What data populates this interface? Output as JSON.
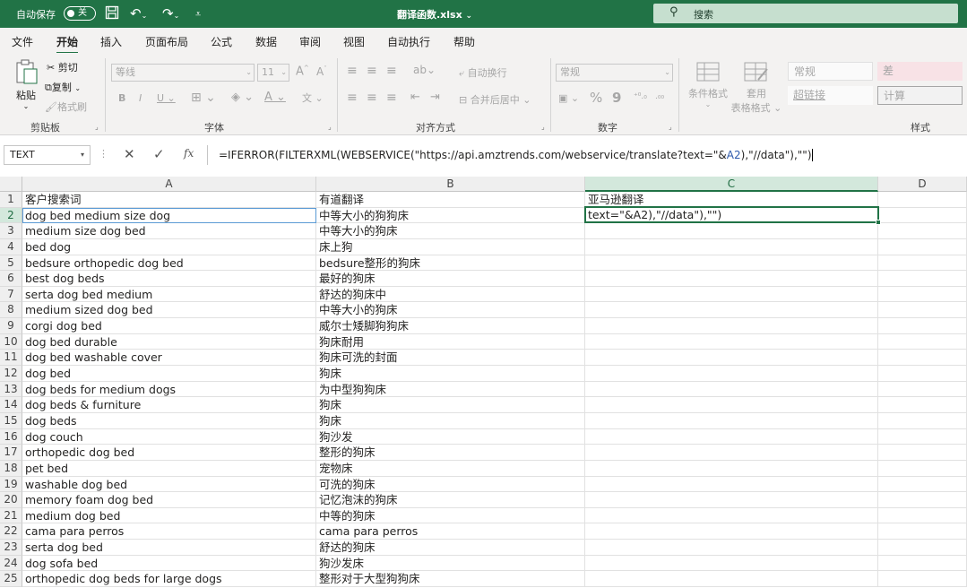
{
  "titlebar": {
    "autosave_label": "自动保存",
    "autosave_state": "关",
    "filename": "翻译函数.xlsx",
    "search_label": "搜索"
  },
  "tabs": [
    "文件",
    "开始",
    "插入",
    "页面布局",
    "公式",
    "数据",
    "审阅",
    "视图",
    "自动执行",
    "帮助"
  ],
  "ribbon": {
    "clipboard": {
      "paste": "粘贴",
      "cut": "剪切",
      "copy": "复制",
      "format_painter": "格式刷",
      "group": "剪贴板"
    },
    "font": {
      "font_name": "等线",
      "font_size": "11",
      "group": "字体"
    },
    "alignment": {
      "wrap": "自动换行",
      "merge": "合并后居中",
      "group": "对齐方式"
    },
    "number": {
      "format": "常规",
      "percent": "%",
      "comma": "9",
      "group": "数字"
    },
    "styles": {
      "conditional": "条件格式",
      "table_format_1": "套用",
      "table_format_2": "表格格式",
      "normal": "常规",
      "bad": "差",
      "hyperlink": "超链接",
      "calc": "计算",
      "group": "样式"
    }
  },
  "formula_bar": {
    "name_box": "TEXT",
    "formula_before": "=IFERROR(FILTERXML(WEBSERVICE(\"https://api.amztrends.com/webservice/translate?text=\"&",
    "formula_ref": "A2",
    "formula_after": "),\"//data\"),\"\")"
  },
  "columns": [
    "A",
    "B",
    "C",
    "D"
  ],
  "active_cell_text": "text=\"&A2),\"//data\"),\"\")",
  "rows": [
    {
      "n": "1",
      "a": "客户搜索词",
      "b": "有道翻译",
      "c": "亚马逊翻译"
    },
    {
      "n": "2",
      "a": "dog bed medium size dog",
      "b": "中等大小的狗狗床",
      "c": ""
    },
    {
      "n": "3",
      "a": "medium size dog bed",
      "b": "中等大小的狗床",
      "c": ""
    },
    {
      "n": "4",
      "a": "bed dog",
      "b": "床上狗",
      "c": ""
    },
    {
      "n": "5",
      "a": "bedsure orthopedic dog bed",
      "b": "bedsure整形的狗床",
      "c": ""
    },
    {
      "n": "6",
      "a": "best dog beds",
      "b": "最好的狗床",
      "c": ""
    },
    {
      "n": "7",
      "a": "serta dog bed medium",
      "b": "舒达的狗床中",
      "c": ""
    },
    {
      "n": "8",
      "a": "medium sized dog bed",
      "b": "中等大小的狗床",
      "c": ""
    },
    {
      "n": "9",
      "a": "corgi dog bed",
      "b": "威尔士矮脚狗狗床",
      "c": ""
    },
    {
      "n": "10",
      "a": "dog bed durable",
      "b": "狗床耐用",
      "c": ""
    },
    {
      "n": "11",
      "a": "dog bed washable cover",
      "b": "狗床可洗的封面",
      "c": ""
    },
    {
      "n": "12",
      "a": "dog bed",
      "b": "狗床",
      "c": ""
    },
    {
      "n": "13",
      "a": "dog beds for medium dogs",
      "b": "为中型狗狗床",
      "c": ""
    },
    {
      "n": "14",
      "a": "dog beds & furniture",
      "b": "狗床",
      "c": ""
    },
    {
      "n": "15",
      "a": "dog beds",
      "b": "狗床",
      "c": ""
    },
    {
      "n": "16",
      "a": "dog couch",
      "b": "狗沙发",
      "c": ""
    },
    {
      "n": "17",
      "a": "orthopedic dog bed",
      "b": "整形的狗床",
      "c": ""
    },
    {
      "n": "18",
      "a": "pet bed",
      "b": "宠物床",
      "c": ""
    },
    {
      "n": "19",
      "a": "washable dog bed",
      "b": "可洗的狗床",
      "c": ""
    },
    {
      "n": "20",
      "a": "memory foam dog bed",
      "b": "记忆泡沫的狗床",
      "c": ""
    },
    {
      "n": "21",
      "a": "medium dog bed",
      "b": "中等的狗床",
      "c": ""
    },
    {
      "n": "22",
      "a": "cama para perros",
      "b": "cama para perros",
      "c": ""
    },
    {
      "n": "23",
      "a": "serta dog bed",
      "b": "舒达的狗床",
      "c": ""
    },
    {
      "n": "24",
      "a": "dog sofa bed",
      "b": "狗沙发床",
      "c": ""
    },
    {
      "n": "25",
      "a": "orthopedic dog beds for large dogs",
      "b": "整形对于大型狗狗床",
      "c": ""
    }
  ],
  "colors": {
    "accent": "#217346",
    "ref_blue": "#2e5aac"
  }
}
